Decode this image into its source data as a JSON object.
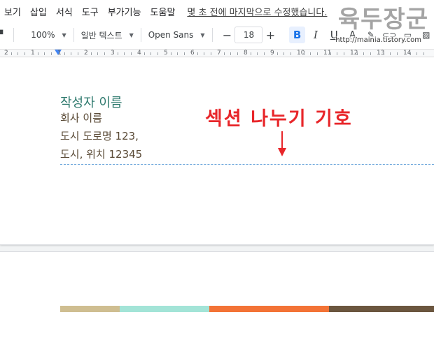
{
  "menu": {
    "items": [
      "보기",
      "삽입",
      "서식",
      "도구",
      "부가기능",
      "도움말"
    ],
    "last_edit": "몇 초 전에 마지막으로 수정했습니다."
  },
  "watermark": {
    "title": "육두장군",
    "url": "http://mainia.tistory.com"
  },
  "toolbar": {
    "zoom": "100%",
    "style": "일반 텍스트",
    "font": "Open Sans",
    "minus": "−",
    "size": "18",
    "plus": "+",
    "bold": "B",
    "italic": "I",
    "underline": "U"
  },
  "ruler": {
    "numbers": [
      "2",
      "1",
      "1",
      "2",
      "3",
      "4",
      "5",
      "6",
      "7",
      "8",
      "9",
      "10",
      "11",
      "12",
      "13",
      "14"
    ]
  },
  "document": {
    "author": "작성자 이름",
    "company": "회사 이름",
    "address1": "도시 도로명 123,",
    "address2": "도시, 위치 12345"
  },
  "annotation": {
    "text": "섹션 나누기 기호",
    "color": "#e8262a"
  },
  "color_bar": {
    "colors": [
      "#cfbe91",
      "#a3e4d7",
      "#f37336",
      "#6b563f"
    ]
  }
}
